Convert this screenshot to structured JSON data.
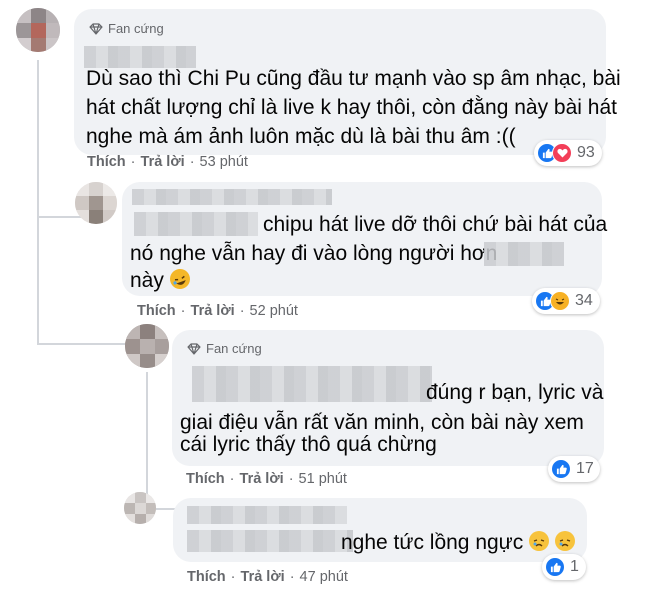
{
  "comments": [
    {
      "badge": "Fan cứng",
      "lines": [
        "Dù sao thì Chi Pu cũng đầu tư mạnh vào sp âm nhạc, bài",
        "hát chất lượng chỉ là live k hay thôi, còn đằng này bài hát",
        "nghe mà ám ảnh luôn mặc dù là bài thu âm :(("
      ],
      "like": "Thích",
      "reply": "Trả lời",
      "time": "53 phút",
      "reaction_count": "93",
      "reactions": [
        "like-icon",
        "love-icon"
      ]
    },
    {
      "badge": "",
      "lines": [
        "chipu hát live dỡ thôi chứ bài hát của",
        "nó nghe vẫn hay đi vào lòng người hơn",
        "này"
      ],
      "emoji": "rolling-laugh-emoji",
      "like": "Thích",
      "reply": "Trả lời",
      "time": "52 phút",
      "reaction_count": "34",
      "reactions": [
        "like-icon",
        "haha-icon"
      ]
    },
    {
      "badge": "Fan cứng",
      "lines": [
        "đúng r bạn, lyric và",
        "giai điệu vẫn rất văn minh, còn bài này xem",
        "cái lyric thấy thô quá chừng"
      ],
      "like": "Thích",
      "reply": "Trả lời",
      "time": "51 phút",
      "reaction_count": "17",
      "reactions": [
        "like-icon"
      ]
    },
    {
      "badge": "",
      "lines": [
        "nghe tức lồng ngực"
      ],
      "emoji": "sad-face-emoji",
      "like": "Thích",
      "reply": "Trả lời",
      "time": "47 phút",
      "reaction_count": "1",
      "reactions": [
        "like-icon"
      ]
    }
  ],
  "colors": {
    "bubble": "#f0f2f5",
    "meta_text": "#65676b",
    "like_blue": "#1877f2",
    "love_red": "#f33e58",
    "haha_yellow": "#f7b125"
  }
}
